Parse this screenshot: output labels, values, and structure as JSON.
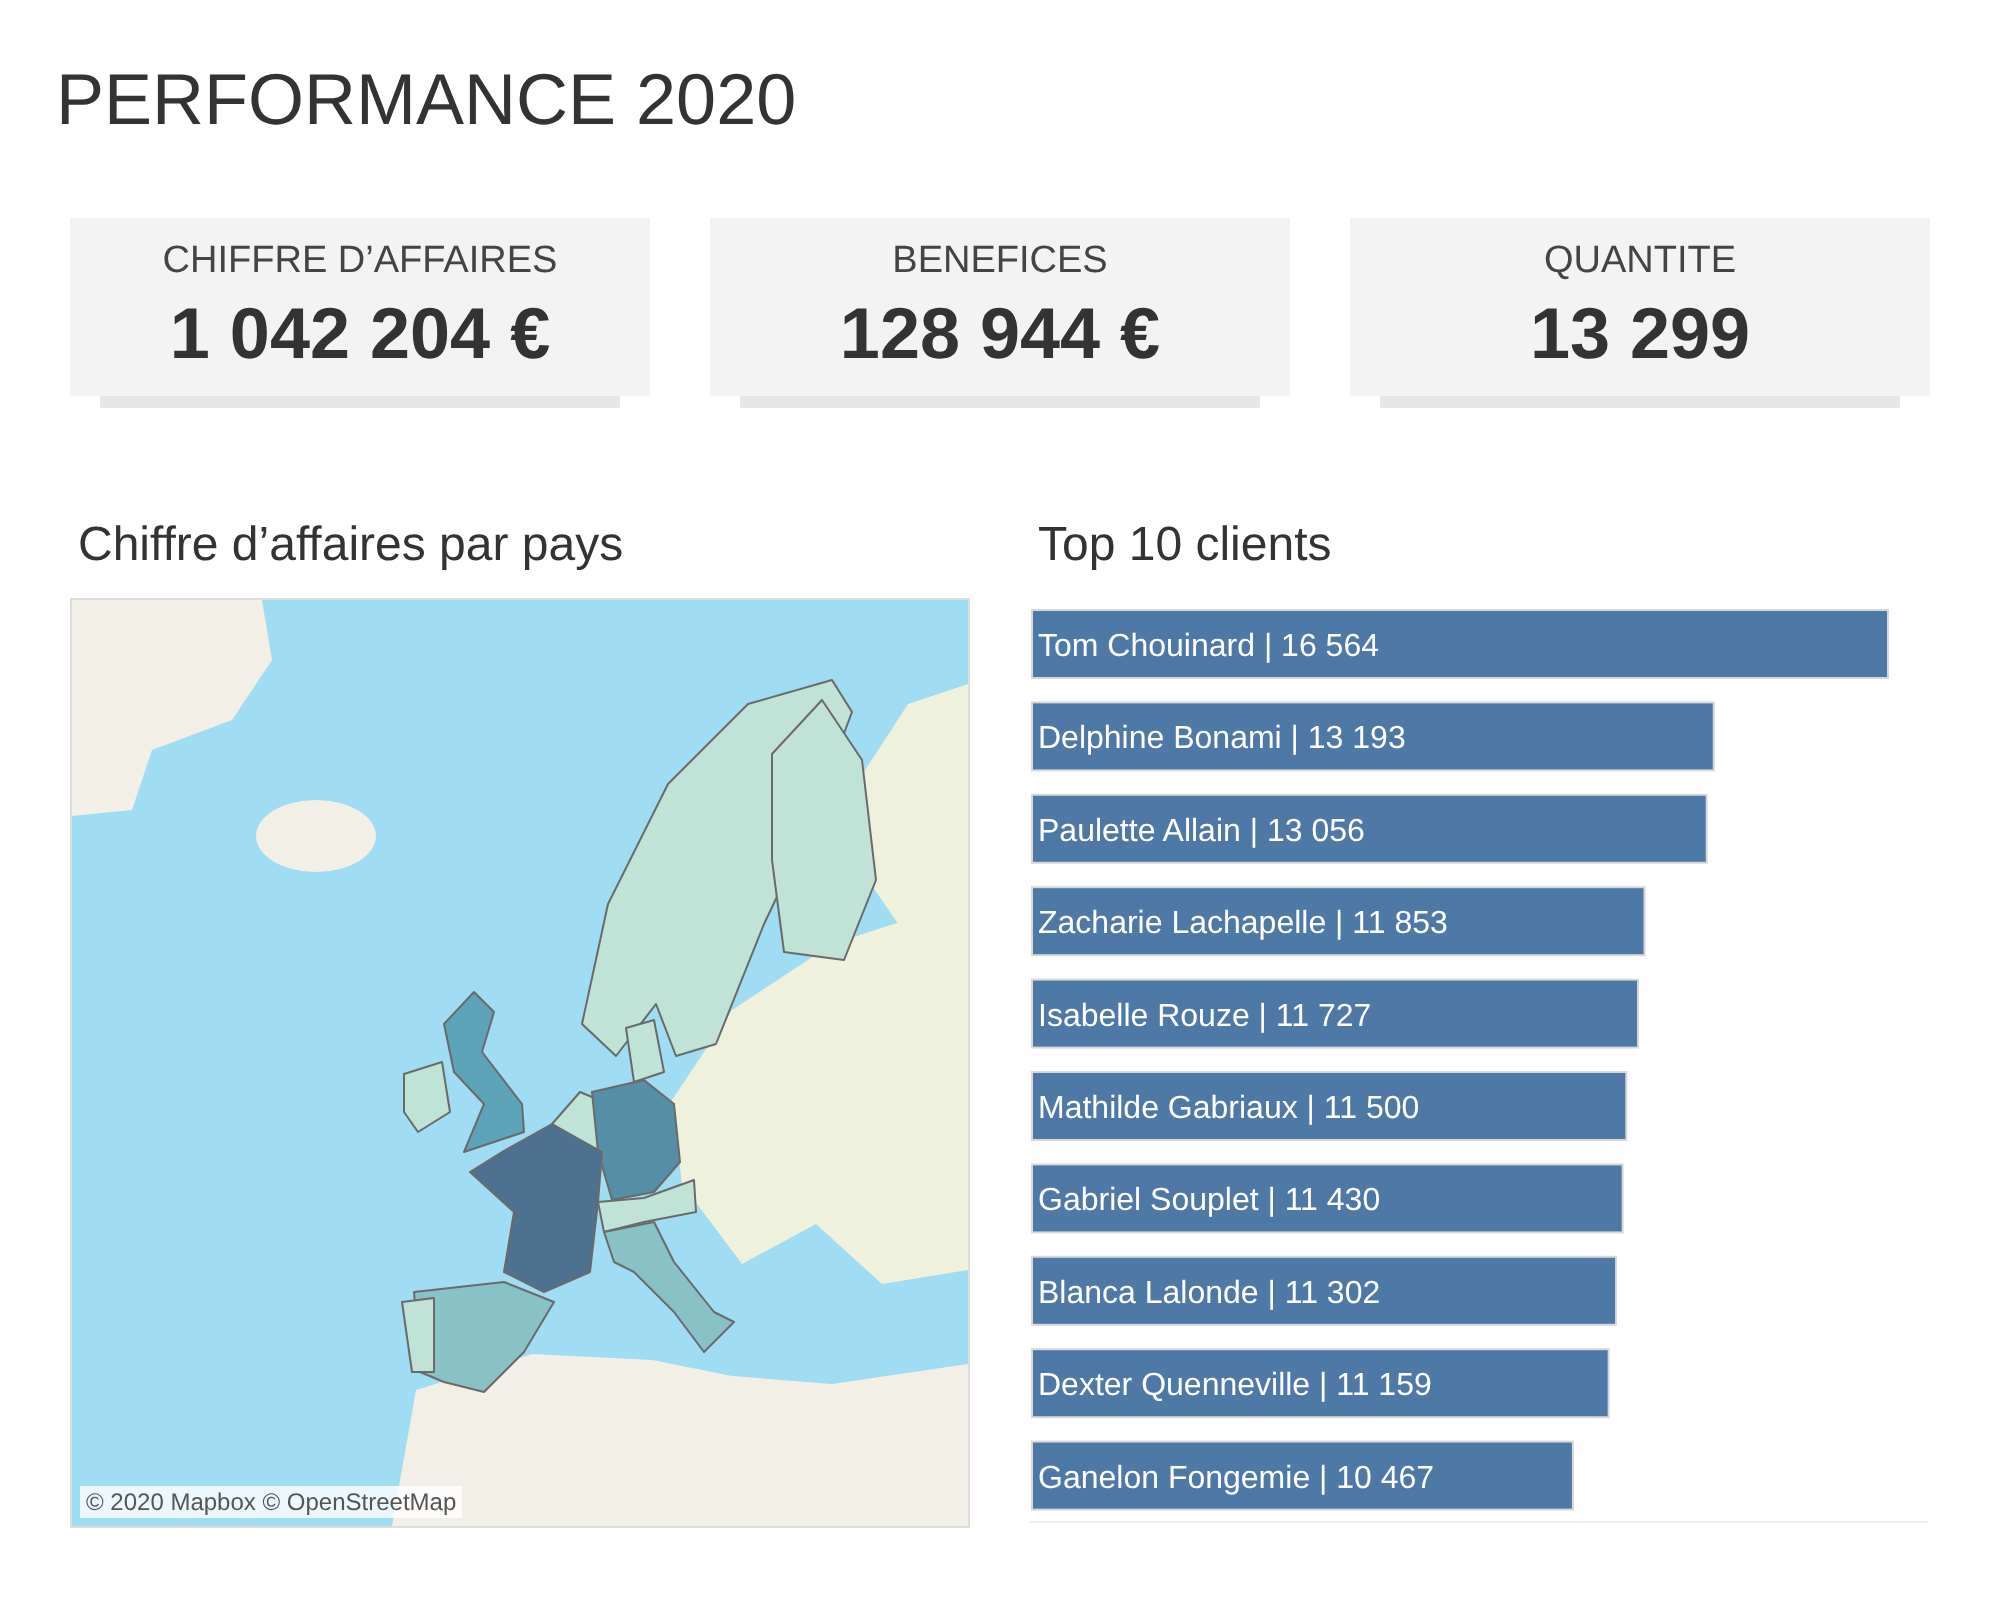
{
  "title": "PERFORMANCE 2020",
  "kpis": [
    {
      "label": "CHIFFRE D’AFFAIRES",
      "value": "1 042 204 €"
    },
    {
      "label": "BENEFICES",
      "value": "128 944 €"
    },
    {
      "label": "QUANTITE",
      "value": "13 299"
    }
  ],
  "map": {
    "title": "Chiffre d’affaires par pays",
    "attribution": "© 2020 Mapbox © OpenStreetMap"
  },
  "top_clients": {
    "title": "Top 10 clients",
    "chart_data": {
      "type": "bar",
      "orientation": "horizontal",
      "categories": [
        "Tom Chouinard",
        "Delphine Bonami",
        "Paulette Allain",
        "Zacharie Lachapelle",
        "Isabelle Rouze",
        "Mathilde Gabriaux",
        "Gabriel Souplet",
        "Blanca Lalonde",
        "Dexter Quenneville",
        "Ganelon Fongemie"
      ],
      "values": [
        16564,
        13193,
        13056,
        11853,
        11727,
        11500,
        11430,
        11302,
        11159,
        10467
      ],
      "value_labels": [
        "| 16 564",
        "| 13 193",
        "| 13 056",
        "| 11 853",
        "| 11 727",
        "| 11 500",
        "| 11 430",
        "| 11 302",
        "| 11 159",
        "| 10 467"
      ]
    }
  }
}
